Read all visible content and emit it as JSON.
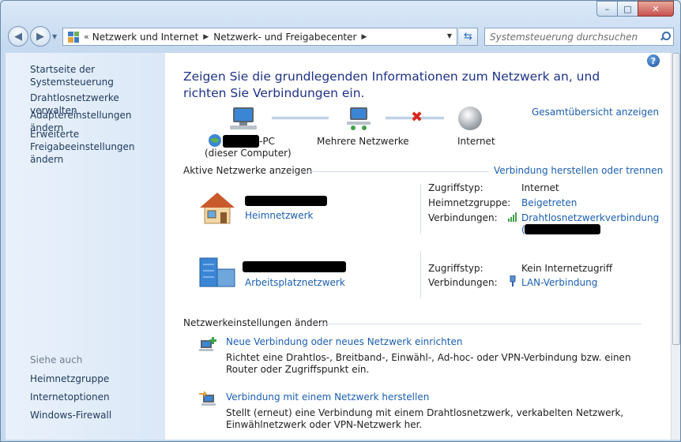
{
  "window": {
    "min_label": "–",
    "max_label": "□",
    "close_label": "✕"
  },
  "address": {
    "crumbs": [
      "Netzwerk und Internet",
      "Netzwerk- und Freigabecenter"
    ],
    "overflow": "«"
  },
  "search": {
    "placeholder": "Systemsteuerung durchsuchen"
  },
  "sidebar": {
    "home": "Startseite der Systemsteuerung",
    "tasks": [
      "Drahtlosnetzwerke verwalten",
      "Adaptereinstellungen ändern",
      "Erweiterte Freigabeeinstellungen ändern"
    ],
    "see_also": "Siehe auch",
    "see_also_links": [
      "Heimnetzgruppe",
      "Internetoptionen",
      "Windows-Firewall"
    ]
  },
  "main": {
    "heading": "Zeigen Sie die grundlegenden Informationen zum Netzwerk an, und richten Sie Verbindungen ein.",
    "full_map_link": "Gesamtübersicht anzeigen",
    "map": {
      "computer_name_suffix": "-PC",
      "computer_sub": "(dieser Computer)",
      "middle_label": "Mehrere Netzwerke",
      "internet_label": "Internet"
    },
    "active_networks": {
      "title": "Aktive Netzwerke anzeigen",
      "connect_link": "Verbindung herstellen oder trennen",
      "networks": [
        {
          "type_link": "Heimnetzwerk",
          "props": [
            {
              "key": "Zugriffstyp:",
              "value": "Internet"
            },
            {
              "key": "Heimnetzgruppe:",
              "value": "Beigetreten"
            },
            {
              "key": "Verbindungen:",
              "value": "Drahtlosnetzwerkverbindung"
            }
          ],
          "connection_extra": "("
        },
        {
          "type_link": "Arbeitsplatznetzwerk",
          "props": [
            {
              "key": "Zugriffstyp:",
              "value": "Kein Internetzugriff"
            },
            {
              "key": "Verbindungen:",
              "value": "LAN-Verbindung"
            }
          ]
        }
      ]
    },
    "change_settings": {
      "title": "Netzwerkeinstellungen ändern",
      "items": [
        {
          "link": "Neue Verbindung oder neues Netzwerk einrichten",
          "desc": "Richtet eine Drahtlos-, Breitband-, Einwähl-, Ad-hoc- oder VPN-Verbindung bzw. einen Router oder Zugriffspunkt ein."
        },
        {
          "link": "Verbindung mit einem Netzwerk herstellen",
          "desc": "Stellt (erneut) eine Verbindung mit einem Drahtlosnetzwerk, verkabelten Netzwerk, Einwählnetzwerk oder VPN-Netzwerk her."
        }
      ]
    }
  },
  "colors": {
    "heading": "#1e3287",
    "link": "#1a5eb0",
    "sidebar_bg": "#dbe8f7",
    "error_x": "#d9261c"
  }
}
